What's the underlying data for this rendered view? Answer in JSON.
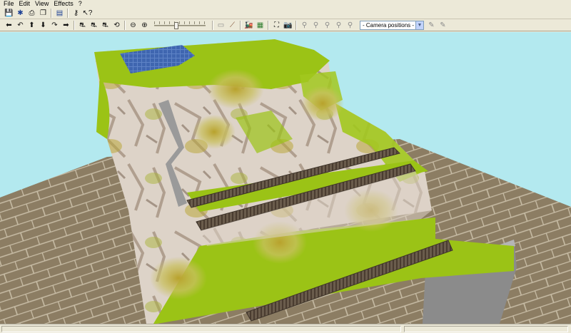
{
  "menubar": {
    "items": [
      "File",
      "Edit",
      "View",
      "Effects",
      "?"
    ]
  },
  "camera": {
    "selected": "- Camera positions -"
  },
  "colors": {
    "sky": "#b3e9ef",
    "grass": "#9bc316",
    "rock": "#ddd3c8",
    "brick": "#8c7d63",
    "track": "#6a5c4c",
    "water": "#3f66b0"
  },
  "icons": {
    "toolbar1": [
      "save-icon",
      "layout-icon",
      "print-icon",
      "copy-icon",
      "paste-icon",
      "key-icon",
      "help-pointer-icon"
    ],
    "toolbar2": [
      "arrow-left-icon",
      "arrow-back-icon",
      "arrow-up-icon",
      "arrow-down-icon",
      "arrow-forward-icon",
      "arrow-right-icon",
      "walk-icon",
      "walk-left-icon",
      "walk-right-icon",
      "rotate-icon",
      "zoom-out-icon",
      "zoom-in-icon",
      "terrain-brush-icon",
      "track-tool-icon",
      "train-icon",
      "landscape-icon",
      "fullscreen-icon",
      "camera-icon",
      "camera-slot-1-icon",
      "camera-slot-2-icon",
      "camera-slot-3-icon",
      "camera-slot-4-icon",
      "camera-slot-5-icon",
      "camera-edit-icon",
      "camera-delete-icon"
    ]
  }
}
